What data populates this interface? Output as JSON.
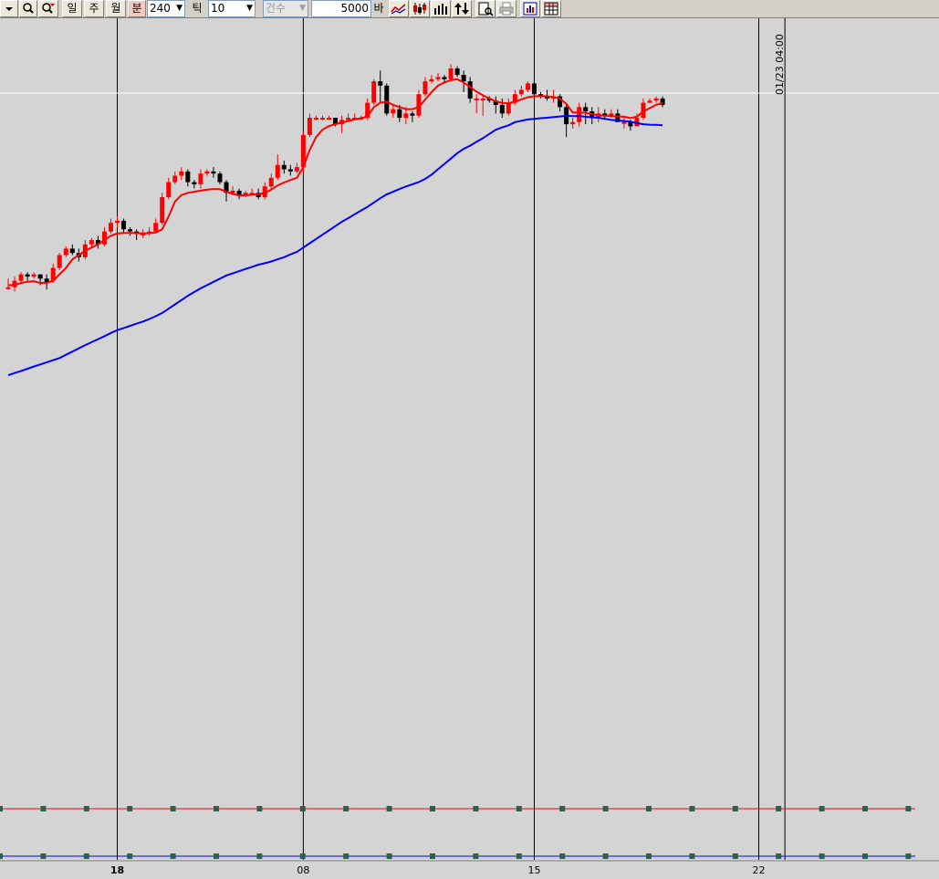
{
  "toolbar": {
    "period_buttons": [
      "일",
      "주",
      "월",
      "분"
    ],
    "interval_value": "240",
    "tick_label": "틱",
    "tick_value": "10",
    "count_select": "건수",
    "bars_value": "5000",
    "bars_unit": "바",
    "icons": [
      "dropdown-arrow-icon",
      "zoom-icon",
      "zoom-out-icon",
      "line-chart-icon",
      "candle-chart-icon",
      "bar-chart-icon",
      "sort-arrows-icon",
      "page-search-icon",
      "printer-icon",
      "export-chart-icon",
      "table-grid-icon"
    ]
  },
  "chart_data": {
    "type": "candlestick",
    "x_ticks": [
      {
        "index": 17,
        "label": "18"
      },
      {
        "index": 46,
        "label": "08"
      },
      {
        "index": 82,
        "label": "15"
      },
      {
        "index": 117,
        "label": "22"
      }
    ],
    "crosshair_label": "01/23 04:00",
    "crosshair_index": 121,
    "colors": {
      "up": "#ff0000",
      "down": "#000000",
      "ma_short": "#ff0000",
      "ma_long": "#0000ff",
      "background": "#d4d4d4",
      "grid": "#000000",
      "crosshair": "#ffffff"
    },
    "candles": [
      [
        18,
        18,
        22,
        17
      ],
      [
        18,
        21,
        23,
        16
      ],
      [
        21,
        24,
        25,
        20
      ],
      [
        24,
        23,
        25,
        21
      ],
      [
        23,
        24,
        25,
        22
      ],
      [
        24,
        22,
        24,
        19
      ],
      [
        22,
        20,
        24,
        17
      ],
      [
        21,
        27,
        29,
        20
      ],
      [
        27,
        33,
        34,
        26
      ],
      [
        33,
        36,
        37,
        32
      ],
      [
        36,
        34,
        38,
        33
      ],
      [
        34,
        32,
        36,
        30
      ],
      [
        32,
        38,
        40,
        31
      ],
      [
        38,
        40,
        41,
        37
      ],
      [
        40,
        38,
        42,
        36
      ],
      [
        38,
        44,
        46,
        37
      ],
      [
        44,
        48,
        50,
        43
      ],
      [
        48,
        49,
        51,
        46
      ],
      [
        49,
        45,
        50,
        43
      ],
      [
        45,
        44,
        46,
        42
      ],
      [
        44,
        43,
        45,
        40
      ],
      [
        43,
        43,
        45,
        41
      ],
      [
        43,
        44,
        46,
        42
      ],
      [
        44,
        48,
        50,
        44
      ],
      [
        48,
        60,
        62,
        47
      ],
      [
        60,
        67,
        69,
        59
      ],
      [
        67,
        70,
        72,
        66
      ],
      [
        70,
        72,
        74,
        68
      ],
      [
        72,
        67,
        73,
        65
      ],
      [
        67,
        66,
        68,
        64
      ],
      [
        66,
        71,
        73,
        64
      ],
      [
        71,
        72,
        73,
        70
      ],
      [
        72,
        71,
        74,
        69
      ],
      [
        71,
        67,
        72,
        66
      ],
      [
        67,
        62,
        68,
        58
      ],
      [
        62,
        63,
        65,
        61
      ],
      [
        63,
        61,
        64,
        59
      ],
      [
        61,
        62,
        63,
        60
      ],
      [
        62,
        62,
        64,
        61
      ],
      [
        62,
        60,
        64,
        59
      ],
      [
        60,
        65,
        67,
        59
      ],
      [
        65,
        69,
        71,
        64
      ],
      [
        69,
        75,
        80,
        68
      ],
      [
        75,
        73,
        77,
        71
      ],
      [
        73,
        72,
        75,
        70
      ],
      [
        72,
        74,
        76,
        71
      ],
      [
        74,
        89,
        91,
        71
      ],
      [
        89,
        97,
        99,
        88
      ],
      [
        97,
        97,
        98,
        96
      ],
      [
        97,
        97,
        98,
        96
      ],
      [
        97,
        97,
        98,
        96
      ],
      [
        97,
        94,
        97,
        93
      ],
      [
        94,
        96,
        98,
        90
      ],
      [
        96,
        97,
        99,
        95
      ],
      [
        97,
        97,
        99,
        96
      ],
      [
        97,
        97,
        98,
        96
      ],
      [
        97,
        104,
        106,
        96
      ],
      [
        104,
        114,
        115,
        103
      ],
      [
        114,
        112,
        119,
        104
      ],
      [
        112,
        99,
        113,
        98
      ],
      [
        99,
        101,
        103,
        97
      ],
      [
        101,
        97,
        103,
        95
      ],
      [
        97,
        99,
        102,
        94
      ],
      [
        99,
        98,
        100,
        95
      ],
      [
        98,
        108,
        110,
        97
      ],
      [
        108,
        114,
        116,
        107
      ],
      [
        114,
        115,
        117,
        113
      ],
      [
        115,
        116,
        118,
        114
      ],
      [
        116,
        115,
        117,
        113
      ],
      [
        115,
        120,
        122,
        114
      ],
      [
        120,
        117,
        121,
        116
      ],
      [
        117,
        114,
        119,
        109
      ],
      [
        114,
        106,
        116,
        104
      ],
      [
        106,
        106,
        108,
        99
      ],
      [
        106,
        106,
        108,
        98
      ],
      [
        106,
        105,
        107,
        104
      ],
      [
        105,
        103,
        107,
        99
      ],
      [
        103,
        99,
        106,
        97
      ],
      [
        99,
        104,
        106,
        98
      ],
      [
        104,
        108,
        110,
        103
      ],
      [
        108,
        110,
        112,
        107
      ],
      [
        110,
        113,
        114,
        109
      ],
      [
        113,
        108,
        114,
        106
      ],
      [
        108,
        107,
        109,
        106
      ],
      [
        107,
        106,
        110,
        105
      ],
      [
        106,
        107,
        110,
        104
      ],
      [
        107,
        102,
        108,
        100
      ],
      [
        102,
        94,
        103,
        88
      ],
      [
        94,
        95,
        97,
        92
      ],
      [
        95,
        102,
        104,
        93
      ],
      [
        102,
        100,
        104,
        94
      ],
      [
        100,
        97,
        102,
        94
      ],
      [
        97,
        99,
        102,
        95
      ],
      [
        99,
        98,
        101,
        96
      ],
      [
        98,
        99,
        101,
        97
      ],
      [
        99,
        95,
        101,
        95
      ],
      [
        95,
        95,
        97,
        92
      ],
      [
        95,
        93,
        96,
        91
      ],
      [
        93,
        97,
        99,
        93
      ],
      [
        97,
        104,
        106,
        96
      ],
      [
        104,
        105,
        106,
        104
      ],
      [
        105,
        106,
        107,
        104
      ],
      [
        106,
        103,
        107,
        102
      ]
    ],
    "ma_short": [
      19,
      19,
      20,
      20.5,
      20.8,
      20,
      20,
      21,
      24,
      27,
      31,
      33,
      35,
      36.5,
      38,
      40,
      42,
      43,
      43.3,
      43.3,
      43.2,
      43.1,
      43.2,
      43.5,
      45,
      51,
      58,
      61,
      62,
      62.5,
      63,
      63.5,
      63.8,
      63.7,
      62.5,
      61.5,
      60.8,
      60.9,
      61.1,
      61.4,
      62,
      63.5,
      65.5,
      66.8,
      68,
      69,
      74,
      82,
      88,
      91.5,
      93.2,
      94,
      94.8,
      95.5,
      96.2,
      96.8,
      97.6,
      102,
      104,
      104.5,
      103,
      102,
      101,
      101,
      102,
      105.5,
      109,
      112,
      113.5,
      114.5,
      115,
      113.5,
      111.3,
      109.2,
      107.5,
      106,
      104.7,
      103.9,
      103.8,
      104.5,
      105.6,
      106.6,
      107,
      107.1,
      107,
      106.7,
      106,
      103.5,
      99.5,
      99.5,
      99.3,
      98.7,
      98.2,
      98,
      97.8,
      97.6,
      97.5,
      96.9,
      97.5,
      100,
      101.5,
      103,
      104
    ],
    "ma_long": [
      -23,
      -22,
      -21,
      -20,
      -19,
      -18,
      -17,
      -16,
      -15,
      -13.5,
      -12,
      -10.5,
      -9,
      -7.6,
      -6.2,
      -4.8,
      -3.3,
      -2,
      -1,
      0,
      1,
      2,
      3.2,
      4.5,
      6,
      8,
      10,
      12,
      14,
      15.8,
      17.5,
      19,
      20.5,
      22,
      23.5,
      24.5,
      25.5,
      26.5,
      27.5,
      28.5,
      29.2,
      30,
      31,
      32,
      33.3,
      34.5,
      36.5,
      38.5,
      40.5,
      42.5,
      44.5,
      46.5,
      48.5,
      50.2,
      52,
      53.8,
      55.5,
      57.5,
      59.5,
      61.3,
      62.5,
      63.8,
      65,
      66,
      67,
      68.5,
      70.5,
      73,
      75.5,
      78,
      80.5,
      82.5,
      84,
      85.8,
      87.5,
      89.5,
      91.4,
      92.5,
      93.5,
      95,
      95.6,
      96.2,
      96.5,
      96.8,
      97,
      97.3,
      97.6,
      97.9,
      97.8,
      97.8,
      97.5,
      97.2,
      97,
      96.5,
      96,
      95.8,
      95.5,
      95.2,
      94.5,
      94,
      93.8,
      93.7,
      93.5
    ],
    "indicator_lines": [
      {
        "name": "red-indicator",
        "color": "#ff0000"
      },
      {
        "name": "blue-indicator",
        "color": "#0000ff"
      }
    ]
  }
}
